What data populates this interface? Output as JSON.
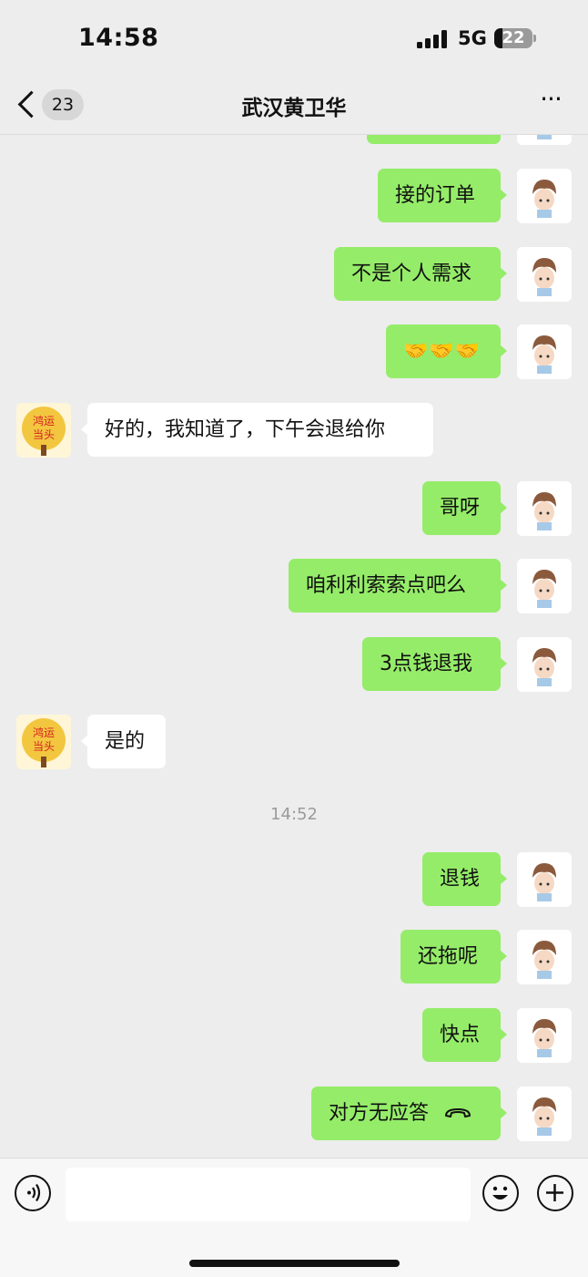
{
  "status": {
    "time": "14:58",
    "network": "5G",
    "battery": "22"
  },
  "nav": {
    "back_count": "23",
    "title": "武汉黄卫华",
    "more": "···"
  },
  "messages": [
    {
      "side": "out",
      "text": ""
    },
    {
      "side": "out",
      "text": "接的订单"
    },
    {
      "side": "out",
      "text": "不是个人需求"
    },
    {
      "side": "out",
      "text": "🤝🤝🤝"
    },
    {
      "side": "in",
      "text": "好的，我知道了，下午会退给你"
    },
    {
      "side": "out",
      "text": "哥呀"
    },
    {
      "side": "out",
      "text": "咱利利索索点吧么"
    },
    {
      "side": "out",
      "text": "3点钱退我"
    },
    {
      "side": "in",
      "text": "是的"
    },
    {
      "side": "out",
      "text": "退钱"
    },
    {
      "side": "out",
      "text": "还拖呢"
    },
    {
      "side": "out",
      "text": "快点"
    },
    {
      "side": "out",
      "text": "对方无应答"
    }
  ],
  "timestamp": "14:52",
  "contact_avatar_text": "鸿运当头",
  "input": {
    "placeholder": ""
  },
  "icons": {
    "voice": "voice-icon",
    "emoji": "emoji-icon",
    "add": "add-icon",
    "call": "phone-hangup-icon"
  },
  "colors": {
    "outgoing_bubble": "#95ec69",
    "incoming_bubble": "#ffffff",
    "background": "#ededed"
  }
}
